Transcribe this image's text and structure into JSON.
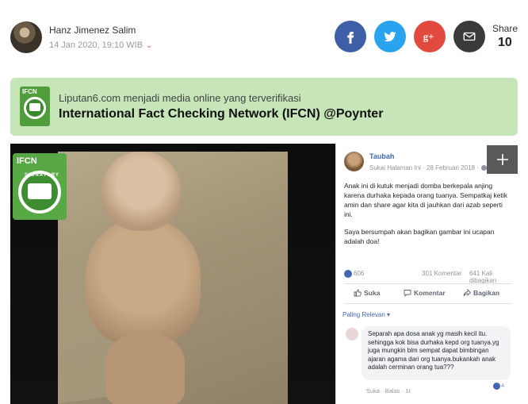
{
  "author": {
    "name": "Hanz Jimenez Salim",
    "date": "14 Jan 2020, 19:10 WIB"
  },
  "share": {
    "label": "Share",
    "count": "10",
    "icons": [
      "facebook-icon",
      "twitter-icon",
      "google-plus-icon",
      "mail-icon"
    ],
    "colors": {
      "facebook": "#3f5ea8",
      "twitter": "#2aa3ef",
      "google_plus": "#e04a3f",
      "mail": "#3a3a3a"
    }
  },
  "banner": {
    "line1": "Liputan6.com menjadi media online yang terverifikasi",
    "line2": "International Fact Checking Network (IFCN) @Poynter",
    "logo_text": "IFCN",
    "background": "#c6e6b9"
  },
  "photo_badge": {
    "ifcn": "IFCN",
    "signatory": "SIGNATORY"
  },
  "fb_post": {
    "name": "Taubah",
    "meta": "Sukai Halaman Ini · 28 Februari 2018 ·",
    "paragraph1": "Anak ini di kutuk menjadi domba berkepala anjing karena durhaka kepada orang tuanya. Sempatkaj ketik amin dan share agar kita di jauhkan dari azab seperti ini.",
    "paragraph2": "Saya bersumpah akan bagikan gambar ini ucapan adalah doa!",
    "reactions": "606",
    "comments": "301 Komentar",
    "shares": "641 Kali dibagikan",
    "actions": {
      "like": "Suka",
      "comment": "Komentar",
      "share": "Bagikan"
    },
    "sort": "Paling Relevan ▾",
    "comment": {
      "text": "Separah apa dosa anak yg masih kecil itu. sehingga kok bisa durhaka kepd org tuanya.yg juga mungkin blm sempat dapat bimbingan ajaran agama dari org tuanya.bukankah anak adalah cerminan orang tua???",
      "meta": "Suka · Balas · 1t",
      "reacts": "4"
    }
  }
}
